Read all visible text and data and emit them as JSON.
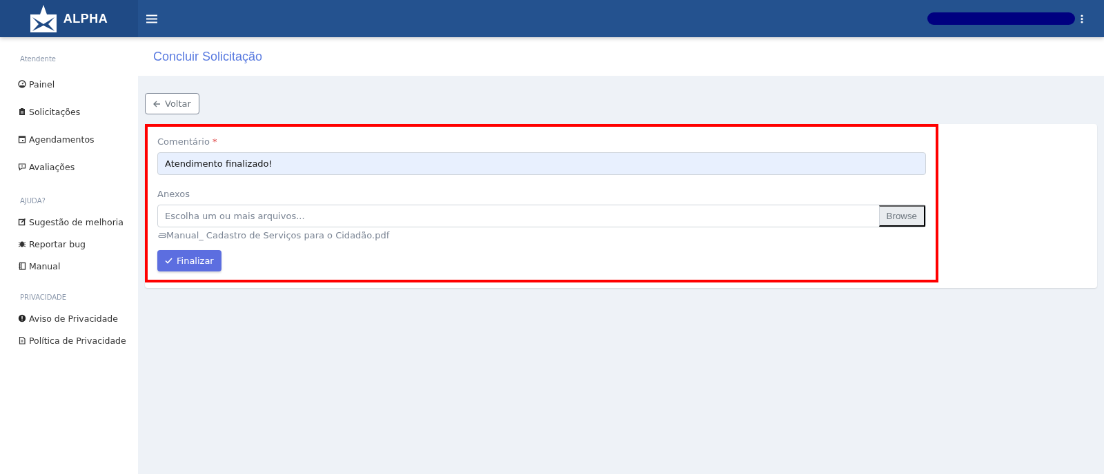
{
  "brand": {
    "name": "ALPHA"
  },
  "sidebar": {
    "sections": [
      {
        "title": "Atendente",
        "items": [
          {
            "label": "Painel"
          },
          {
            "label": "Solicitações"
          },
          {
            "label": "Agendamentos"
          },
          {
            "label": "Avaliações"
          }
        ]
      },
      {
        "title": "AJUDA?",
        "items": [
          {
            "label": "Sugestão de melhoria"
          },
          {
            "label": "Reportar bug"
          },
          {
            "label": "Manual"
          }
        ]
      },
      {
        "title": "PRIVACIDADE",
        "items": [
          {
            "label": "Aviso de Privacidade"
          },
          {
            "label": "Política de Privacidade"
          }
        ]
      }
    ]
  },
  "page": {
    "title": "Concluir Solicitação",
    "back_button": "Voltar"
  },
  "form": {
    "comment": {
      "label": "Comentário",
      "required_mark": "*",
      "value": "Atendimento finalizado!"
    },
    "attachments": {
      "label": "Anexos",
      "placeholder": "Escolha um ou mais arquivos...",
      "browse": "Browse",
      "files": [
        "Manual_ Cadastro de Serviços para o Cidadão.pdf"
      ]
    },
    "submit": "Finalizar"
  }
}
